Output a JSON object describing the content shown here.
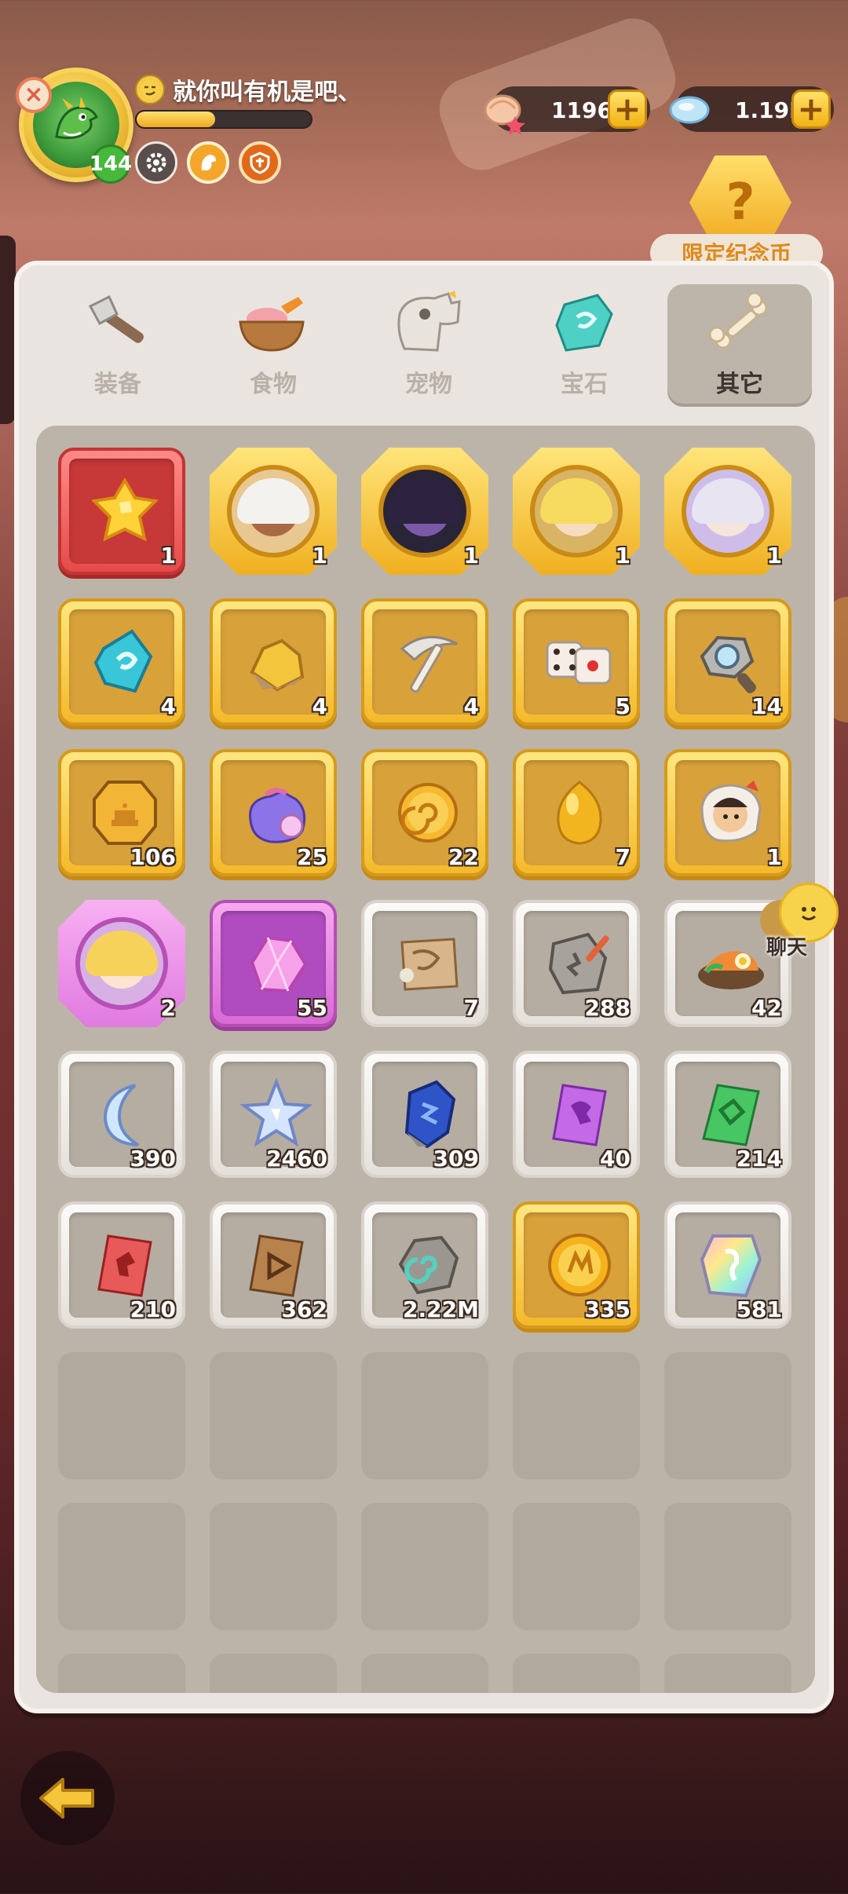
{
  "player": {
    "name": "就你叫有机是吧、",
    "level": "144",
    "exp_fraction": 0.45,
    "close_glyph": "×"
  },
  "currencies": [
    {
      "icon": "shell-star-icon",
      "value": "1196",
      "plus": "+"
    },
    {
      "icon": "crystal-icon",
      "value": "1.19M",
      "plus": "+"
    }
  ],
  "limited_coin": {
    "label": "限定纪念币",
    "glyph": "?"
  },
  "tabs": [
    {
      "label": "装备",
      "icon": "equipment-axe-icon",
      "active": false
    },
    {
      "label": "食物",
      "icon": "food-bowl-icon",
      "active": false
    },
    {
      "label": "宠物",
      "icon": "pet-dino-skull-icon",
      "active": false
    },
    {
      "label": "宝石",
      "icon": "gem-icon",
      "active": false
    },
    {
      "label": "其它",
      "icon": "bone-icon",
      "active": true
    }
  ],
  "items": [
    {
      "name": "gold-star-chunk",
      "frame": "red",
      "count": "1"
    },
    {
      "name": "hero-portrait-white-hair",
      "frame": "oct-gold",
      "count": "1"
    },
    {
      "name": "hero-portrait-dark-masked",
      "frame": "oct-gold",
      "count": "1"
    },
    {
      "name": "hero-portrait-blonde",
      "frame": "oct-gold",
      "count": "1"
    },
    {
      "name": "hero-portrait-silver-hair",
      "frame": "oct-gold",
      "count": "1"
    },
    {
      "name": "blue-rune-stone",
      "frame": "gold",
      "count": "4"
    },
    {
      "name": "gold-ore",
      "frame": "gold",
      "count": "4"
    },
    {
      "name": "pickaxe",
      "frame": "gold",
      "count": "4"
    },
    {
      "name": "dice",
      "frame": "gold",
      "count": "5"
    },
    {
      "name": "magnifier-stone",
      "frame": "gold",
      "count": "14"
    },
    {
      "name": "cake-coin",
      "frame": "gold",
      "count": "106"
    },
    {
      "name": "purple-lucky-bag",
      "frame": "gold",
      "count": "25"
    },
    {
      "name": "gold-spiral-coin",
      "frame": "gold",
      "count": "22"
    },
    {
      "name": "gold-egg",
      "frame": "gold",
      "count": "7"
    },
    {
      "name": "caveman-skin",
      "frame": "gold",
      "count": "1"
    },
    {
      "name": "hero-portrait-pink",
      "frame": "oct-purple",
      "count": "2"
    },
    {
      "name": "pink-crystal",
      "frame": "purple",
      "count": "55"
    },
    {
      "name": "treasure-map",
      "frame": "white",
      "count": "7"
    },
    {
      "name": "stone-tablet",
      "frame": "white",
      "count": "288"
    },
    {
      "name": "food-platter",
      "frame": "white",
      "count": "42"
    },
    {
      "name": "moon-shard",
      "frame": "white",
      "count": "390"
    },
    {
      "name": "star-shard",
      "frame": "white",
      "count": "2460"
    },
    {
      "name": "blue-rune-crystal",
      "frame": "white",
      "count": "309"
    },
    {
      "name": "purple-dino-ticket",
      "frame": "white",
      "count": "40"
    },
    {
      "name": "green-ticket",
      "frame": "white",
      "count": "214"
    },
    {
      "name": "red-ticket",
      "frame": "white",
      "count": "210"
    },
    {
      "name": "brown-ticket",
      "frame": "white",
      "count": "362"
    },
    {
      "name": "spiral-rock",
      "frame": "white",
      "count": "2.22M"
    },
    {
      "name": "gold-rune-coin",
      "frame": "gold",
      "count": "335"
    },
    {
      "name": "rainbow-crystal",
      "frame": "white",
      "count": "581"
    }
  ],
  "chat": {
    "label": "聊天"
  },
  "colors": {
    "gold_frame": "#f4b92a",
    "red_frame": "#e64a4a",
    "purple_frame": "#d86ad6",
    "white_frame": "#e5e0da",
    "active_tab": "#bdb4aa"
  }
}
